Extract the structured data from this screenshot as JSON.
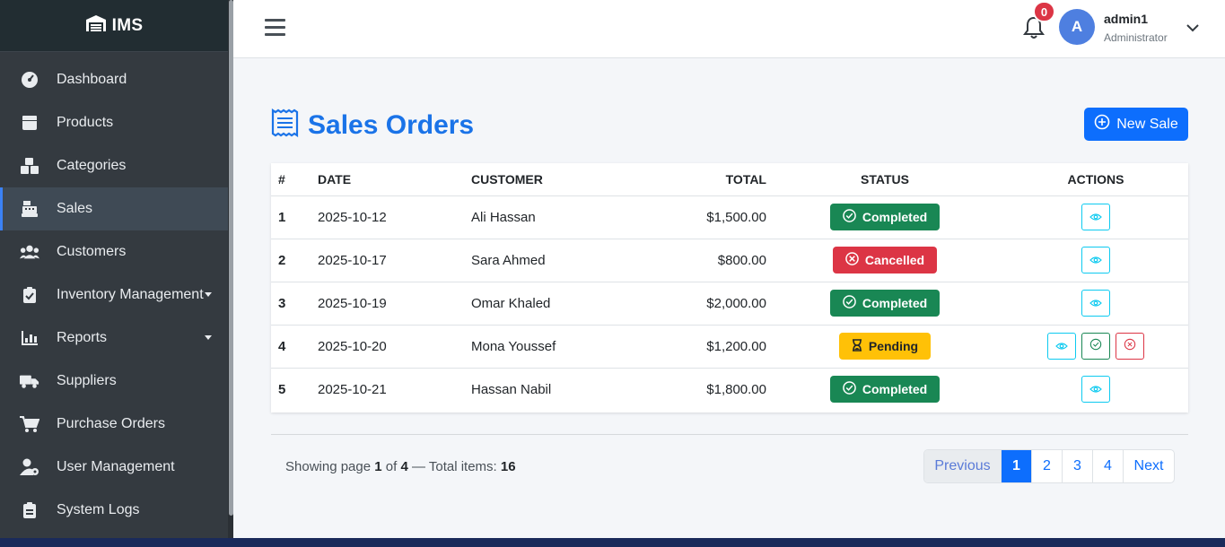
{
  "app": {
    "brand": "IMS"
  },
  "sidebar": {
    "items": [
      {
        "label": "Dashboard",
        "icon": "gauge-icon"
      },
      {
        "label": "Products",
        "icon": "box-icon"
      },
      {
        "label": "Categories",
        "icon": "boxes-icon"
      },
      {
        "label": "Sales",
        "icon": "cash-register-icon"
      },
      {
        "label": "Customers",
        "icon": "users-icon"
      },
      {
        "label": "Inventory Management",
        "icon": "clipboard-check-icon"
      },
      {
        "label": "Reports",
        "icon": "chart-icon"
      },
      {
        "label": "Suppliers",
        "icon": "truck-icon"
      },
      {
        "label": "Purchase Orders",
        "icon": "cart-icon"
      },
      {
        "label": "User Management",
        "icon": "user-gear-icon"
      },
      {
        "label": "System Logs",
        "icon": "clipboard-list-icon"
      }
    ],
    "active": "Sales"
  },
  "topbar": {
    "notifications_count": "0",
    "user_initial": "A",
    "user_name": "admin1",
    "user_role": "Administrator"
  },
  "page": {
    "title": "Sales Orders",
    "new_button": "New Sale"
  },
  "table": {
    "headers": [
      "#",
      "DATE",
      "CUSTOMER",
      "TOTAL",
      "STATUS",
      "ACTIONS"
    ],
    "rows": [
      {
        "num": "1",
        "date": "2025-10-12",
        "customer": "Ali Hassan",
        "total": "$1,500.00",
        "status": "Completed"
      },
      {
        "num": "2",
        "date": "2025-10-17",
        "customer": "Sara Ahmed",
        "total": "$800.00",
        "status": "Cancelled"
      },
      {
        "num": "3",
        "date": "2025-10-19",
        "customer": "Omar Khaled",
        "total": "$2,000.00",
        "status": "Completed"
      },
      {
        "num": "4",
        "date": "2025-10-20",
        "customer": "Mona Youssef",
        "total": "$1,200.00",
        "status": "Pending"
      },
      {
        "num": "5",
        "date": "2025-10-21",
        "customer": "Hassan Nabil",
        "total": "$1,800.00",
        "status": "Completed"
      }
    ]
  },
  "pagination": {
    "showing_prefix": "Showing page",
    "current_page": "1",
    "of_label": "of",
    "total_pages": "4",
    "total_label": "— Total items:",
    "total_items": "16",
    "prev_label": "Previous",
    "next_label": "Next",
    "pages": [
      "1",
      "2",
      "3",
      "4"
    ]
  },
  "colors": {
    "primary": "#0d6efd",
    "success": "#198754",
    "danger": "#dc3545",
    "warning": "#ffc107",
    "sidebar_bg": "#343a40"
  }
}
